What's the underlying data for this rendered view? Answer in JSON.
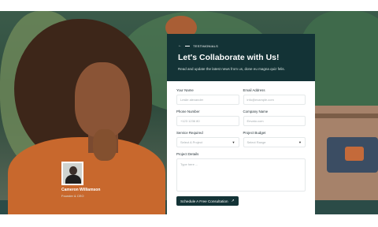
{
  "testimonial": {
    "name": "Cameron Williamson",
    "role": "Founder & CEO"
  },
  "contact_card": {
    "tag": "TESTIMONIALS",
    "title": "Let's Collaborate with Us!",
    "subtitle": "Read and update the latest news from us, done eu magna quiz felis.",
    "fields": {
      "name": {
        "label": "Your Name",
        "placeholder": "Leslie alexander"
      },
      "email": {
        "label": "Email Address",
        "placeholder": "info@example.com"
      },
      "phone": {
        "label": "Phone Number",
        "placeholder": "+123 1236 80"
      },
      "company": {
        "label": "Company Name",
        "placeholder": "Envato.com"
      },
      "service": {
        "label": "Service Required",
        "value": "Select A Project"
      },
      "budget": {
        "label": "Project Budget",
        "value": "Select Range"
      },
      "details": {
        "label": "Project Details",
        "placeholder": "Type here ..."
      }
    },
    "submit_label": "Schedule A Free Consultation",
    "colors": {
      "primary": "#133336",
      "accent_white": "#ffffff"
    }
  },
  "icons": {
    "tag_arrow": "arrow-left-icon",
    "submit_arrow": "arrow-up-right-icon",
    "dropdown": "chevron-down-icon"
  }
}
